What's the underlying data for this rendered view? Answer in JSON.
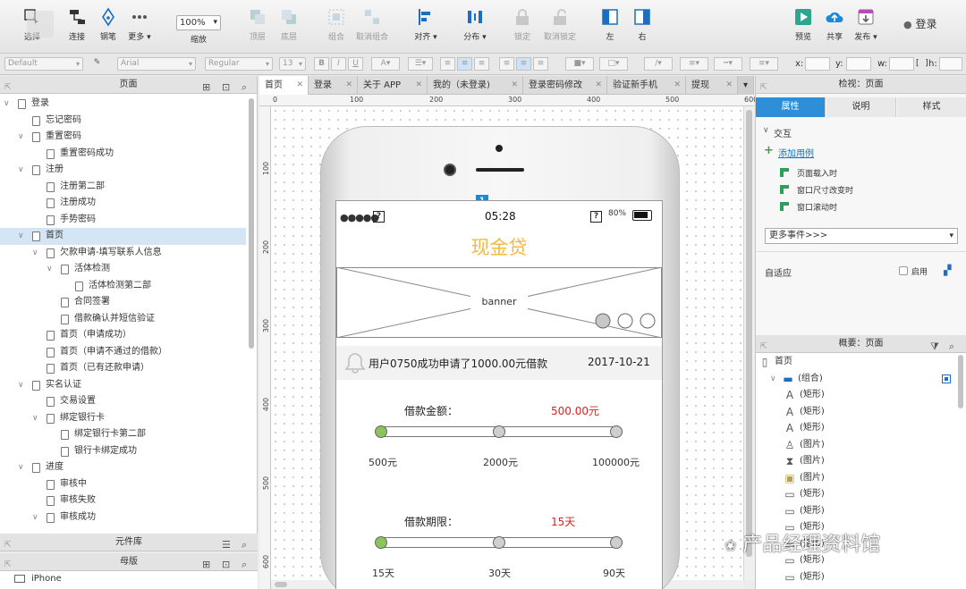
{
  "toolbar": {
    "zoom_value": "100%",
    "items": [
      {
        "key": "select",
        "label": "选择"
      },
      {
        "key": "connect",
        "label": "连接"
      },
      {
        "key": "pen",
        "label": "钢笔"
      },
      {
        "key": "more",
        "label": "更多 ▾"
      },
      {
        "key": "zoom",
        "label": "缩放"
      },
      {
        "key": "top",
        "label": "顶层"
      },
      {
        "key": "bottom",
        "label": "底层"
      },
      {
        "key": "group",
        "label": "组合"
      },
      {
        "key": "ungroup",
        "label": "取消组合"
      },
      {
        "key": "align",
        "label": "对齐 ▾"
      },
      {
        "key": "distribute",
        "label": "分布 ▾"
      },
      {
        "key": "lock",
        "label": "锁定"
      },
      {
        "key": "unlock",
        "label": "取消锁定"
      },
      {
        "key": "left",
        "label": "左"
      },
      {
        "key": "right",
        "label": "右"
      },
      {
        "key": "preview",
        "label": "预览"
      },
      {
        "key": "share",
        "label": "共享"
      },
      {
        "key": "publish",
        "label": "发布 ▾"
      }
    ],
    "login_label": "登录"
  },
  "formatbar": {
    "style_value": "Default",
    "font_value": "Arial",
    "weight_value": "Regular",
    "size_value": "13",
    "bold": "B",
    "italic": "I",
    "underline": "U",
    "x_label": "x:",
    "y_label": "y:",
    "w_label": "w:",
    "h_label": "h:"
  },
  "pages_panel": {
    "title": "页面",
    "items": [
      {
        "label": "登录",
        "level": 0,
        "chev": "v"
      },
      {
        "label": "忘记密码",
        "level": 1,
        "chev": ""
      },
      {
        "label": "重置密码",
        "level": 1,
        "chev": "v"
      },
      {
        "label": "重置密码成功",
        "level": 2,
        "chev": ""
      },
      {
        "label": "注册",
        "level": 1,
        "chev": "v"
      },
      {
        "label": "注册第二部",
        "level": 2,
        "chev": ""
      },
      {
        "label": "注册成功",
        "level": 2,
        "chev": ""
      },
      {
        "label": "手势密码",
        "level": 2,
        "chev": ""
      },
      {
        "label": "首页",
        "level": 1,
        "chev": "v",
        "selected": true
      },
      {
        "label": "欠款申请-填写联系人信息",
        "level": 2,
        "chev": "v"
      },
      {
        "label": "活体检测",
        "level": 3,
        "chev": "v"
      },
      {
        "label": "活体检测第二部",
        "level": 4,
        "chev": ""
      },
      {
        "label": "合同签署",
        "level": 3,
        "chev": ""
      },
      {
        "label": "借款确认并短信验证",
        "level": 3,
        "chev": ""
      },
      {
        "label": "首页（申请成功）",
        "level": 2,
        "chev": ""
      },
      {
        "label": "首页（申请不通过的借款）",
        "level": 2,
        "chev": ""
      },
      {
        "label": "首页（已有还款申请）",
        "level": 2,
        "chev": ""
      },
      {
        "label": "实名认证",
        "level": 1,
        "chev": "v"
      },
      {
        "label": "交易设置",
        "level": 2,
        "chev": ""
      },
      {
        "label": "绑定银行卡",
        "level": 2,
        "chev": "v"
      },
      {
        "label": "绑定银行卡第二部",
        "level": 3,
        "chev": ""
      },
      {
        "label": "银行卡绑定成功",
        "level": 3,
        "chev": ""
      },
      {
        "label": "进度",
        "level": 1,
        "chev": "v"
      },
      {
        "label": "审核中",
        "level": 2,
        "chev": ""
      },
      {
        "label": "审核失败",
        "level": 2,
        "chev": ""
      },
      {
        "label": "审核成功",
        "level": 2,
        "chev": "v"
      }
    ]
  },
  "library_panel": {
    "title": "元件库"
  },
  "master_panel": {
    "title": "母版",
    "items": [
      "iPhone"
    ]
  },
  "tabs": [
    {
      "label": "首页",
      "active": true
    },
    {
      "label": "登录"
    },
    {
      "label": "关于 APP"
    },
    {
      "label": "我的（未登录)"
    },
    {
      "label": "登录密码修改"
    },
    {
      "label": "验证新手机"
    },
    {
      "label": "提现"
    }
  ],
  "rulers": {
    "top": [
      "0",
      "100",
      "200",
      "300",
      "400",
      "500",
      "600"
    ],
    "left": [
      "100",
      "200",
      "300",
      "400",
      "500",
      "600"
    ]
  },
  "mockup": {
    "badge": "1",
    "status_time": "05:28",
    "battery_pct": "80%",
    "app_title": "现金贷",
    "banner_label": "banner",
    "notice_text": "用户0750成功申请了1000.00元借款",
    "notice_date": "2017-10-21",
    "amount_label": "借款金额：",
    "amount_value": "500.00元",
    "amount_ticks": [
      "500元",
      "2000元",
      "100000元"
    ],
    "term_label": "借款期限：",
    "term_value": "15天",
    "term_ticks": [
      "15天",
      "30天",
      "90天"
    ],
    "accent_color": "#f5b840",
    "value_color": "#e02020"
  },
  "inspector": {
    "title": "检视：页面",
    "tabs": [
      "属性",
      "说明",
      "样式"
    ],
    "section_interaction": "交互",
    "add_case": "添加用例",
    "events": [
      "页面载入时",
      "窗口尺寸改变时",
      "窗口滚动时"
    ],
    "more_events": "更多事件>>>",
    "adaptive_label": "自适应",
    "enable_label": "启用"
  },
  "outline": {
    "title": "概要：页面",
    "items": [
      {
        "label": "首页",
        "icon": "page",
        "level": 0
      },
      {
        "label": "(组合)",
        "icon": "folder",
        "level": 1
      },
      {
        "label": "(矩形)",
        "icon": "text",
        "level": 2
      },
      {
        "label": "(矩形)",
        "icon": "text",
        "level": 2
      },
      {
        "label": "(矩形)",
        "icon": "text",
        "level": 2
      },
      {
        "label": "(图片)",
        "icon": "person",
        "level": 2
      },
      {
        "label": "(图片)",
        "icon": "hourglass",
        "level": 2
      },
      {
        "label": "(图片)",
        "icon": "image",
        "level": 2
      },
      {
        "label": "(矩形)",
        "icon": "rect",
        "level": 2
      },
      {
        "label": "(矩形)",
        "icon": "rect",
        "level": 2
      },
      {
        "label": "(矩形)",
        "icon": "rect",
        "level": 2
      },
      {
        "label": "(矩形)",
        "icon": "rect",
        "level": 2
      },
      {
        "label": "(矩形)",
        "icon": "rect",
        "level": 2
      },
      {
        "label": "(矩形)",
        "icon": "rect",
        "level": 2
      }
    ]
  },
  "watermark": "产品经理资料馆"
}
